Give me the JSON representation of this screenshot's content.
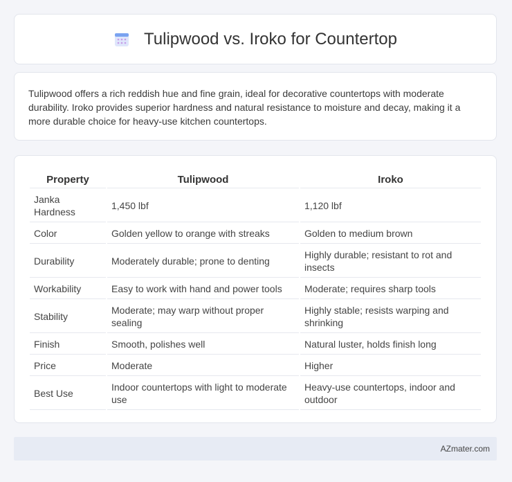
{
  "header": {
    "title": "Tulipwood vs. Iroko for Countertop",
    "icon": "calendar-icon"
  },
  "intro": "Tulipwood offers a rich reddish hue and fine grain, ideal for decorative countertops with moderate durability. Iroko provides superior hardness and natural resistance to moisture and decay, making it a more durable choice for heavy-use kitchen countertops.",
  "table": {
    "headers": [
      "Property",
      "Tulipwood",
      "Iroko"
    ],
    "rows": [
      [
        "Janka Hardness",
        "1,450 lbf",
        "1,120 lbf"
      ],
      [
        "Color",
        "Golden yellow to orange with streaks",
        "Golden to medium brown"
      ],
      [
        "Durability",
        "Moderately durable; prone to denting",
        "Highly durable; resistant to rot and insects"
      ],
      [
        "Workability",
        "Easy to work with hand and power tools",
        "Moderate; requires sharp tools"
      ],
      [
        "Stability",
        "Moderate; may warp without proper sealing",
        "Highly stable; resists warping and shrinking"
      ],
      [
        "Finish",
        "Smooth, polishes well",
        "Natural luster, holds finish long"
      ],
      [
        "Price",
        "Moderate",
        "Higher"
      ],
      [
        "Best Use",
        "Indoor countertops with light to moderate use",
        "Heavy-use countertops, indoor and outdoor"
      ]
    ]
  },
  "footer": {
    "brand": "AZmater.com"
  }
}
